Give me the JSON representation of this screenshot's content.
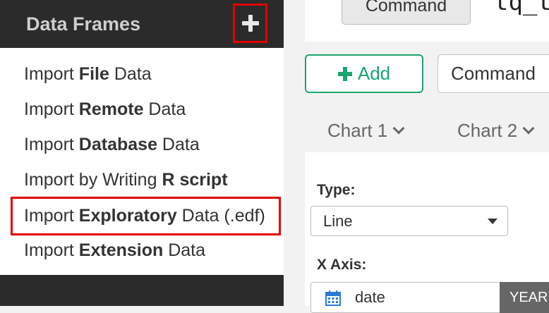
{
  "sidebar": {
    "title": "Data Frames",
    "menu": [
      {
        "pre": "Import ",
        "bold": "File",
        "post": " Data"
      },
      {
        "pre": "Import ",
        "bold": "Remote",
        "post": " Data"
      },
      {
        "pre": "Import ",
        "bold": "Database",
        "post": " Data"
      },
      {
        "pre": "Import by Writing ",
        "bold": "R script",
        "post": ""
      },
      {
        "pre": "Import ",
        "bold": "Exploratory",
        "post": " Data (.edf)"
      },
      {
        "pre": "Import ",
        "bold": "Extension",
        "post": " Data"
      }
    ]
  },
  "main": {
    "top_command_label": "Command",
    "top_text": "tq_tr",
    "add_label": "Add",
    "command_label": "Command",
    "tabs": [
      "Chart 1",
      "Chart 2"
    ],
    "type_label": "Type:",
    "type_value": "Line",
    "x_axis_label": "X Axis:",
    "x_axis_value": "date",
    "x_axis_unit": "YEAR"
  },
  "colors": {
    "accent_green": "#1aa56d",
    "highlight_red": "#e30000",
    "sidebar_dark": "#2b2b2b"
  }
}
